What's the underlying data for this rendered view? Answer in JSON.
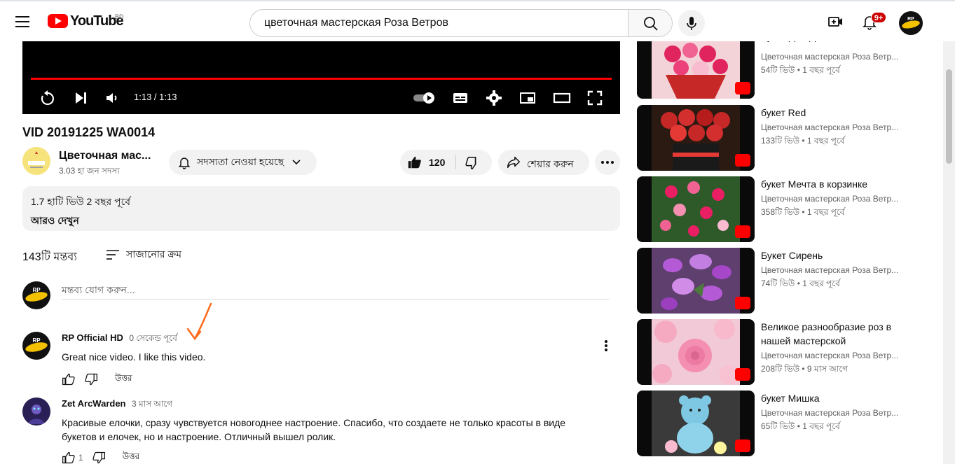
{
  "header": {
    "logo_text": "YouTube",
    "country_code": "BD",
    "search_value": "цветочная мастерская Роза Ветров",
    "notification_count": "9+",
    "profile_avatar_text": "RP OFFICIAL HD"
  },
  "player": {
    "time": "1:13 / 1:13",
    "progress": 1.0
  },
  "video": {
    "title": "VID 20191225 WA0014",
    "channel_name": "Цветочная мас...",
    "subscribers": "3.03 হা জন সদস্য",
    "subscribe_label": "সদস্যতা নেওয়া হয়েছে",
    "likes": "120",
    "share_label": "শেয়ার করুন"
  },
  "description": {
    "stats": "1.7 হাটি ভিউ  2 বছর পূর্বে",
    "more": "আরও দেখুন"
  },
  "comments": {
    "count": "143টি মন্তব্য",
    "sort_label": "সাজানোর ক্রম",
    "add_placeholder": "মন্তব্য যোগ করুন...",
    "my_avatar_text": "RP OFFICIAL HD",
    "items": [
      {
        "author": "RP Official HD",
        "time": "0 সেকেন্ড পূর্বে",
        "text": "Great nice video. I like this video.",
        "likes": "",
        "reply": "উত্তর"
      },
      {
        "author": "Zet ArcWarden",
        "time": "3 মাস আগে",
        "text": "Красивые елочки, сразу чувствуется новогоднее настроение. Спасибо, что создаете не только красоты в виде букетов и елочек, но и настроение. Отличный вышел ролик.",
        "likes": "1",
        "reply": "উত্তর"
      }
    ]
  },
  "sidebar": {
    "items": [
      {
        "title": "Букет Для Дамы",
        "channel": "Цветочная мастерская Роза Ветр...",
        "meta": "54টি ভিউ  • 1 বছর পূর্বে"
      },
      {
        "title": "букет Red",
        "channel": "Цветочная мастерская Роза Ветр...",
        "meta": "133টি ভিউ  • 1 বছর পূর্বে"
      },
      {
        "title": "букет Мечта в корзинке",
        "channel": "Цветочная мастерская Роза Ветр...",
        "meta": "358টি ভিউ  • 1 বছর পূর্বে"
      },
      {
        "title": "Букет Сирень",
        "channel": "Цветочная мастерская Роза Ветр...",
        "meta": "74টি ভিউ  • 1 বছর পূর্বে"
      },
      {
        "title": "Великое разнообразие роз в нашей мастерской",
        "channel": "Цветочная мастерская Роза Ветр...",
        "meta": "208টি ভিউ  • 9 মাস আগে"
      },
      {
        "title": "букет Мишка",
        "channel": "Цветочная мастерская Роза Ветр...",
        "meta": "65টি ভিউ  • 1 বছর পূর্বে"
      }
    ]
  },
  "colors": {
    "brand_red": "#ff0000",
    "annotation_arrow": "#ff6a1a"
  }
}
